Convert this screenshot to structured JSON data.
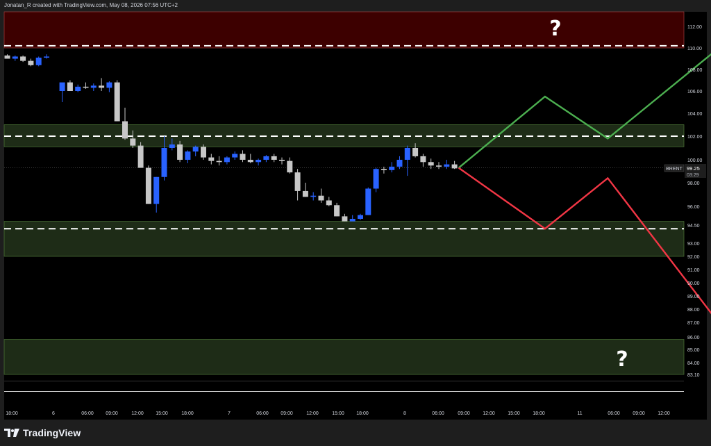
{
  "header": {
    "caption": "Jonatan_R created with TradingView.com, May 08, 2026 07:56 UTC+2"
  },
  "brand": {
    "name": "TradingView",
    "logo_icon": "tradingview-logo-icon"
  },
  "symbol_label": "BRENT",
  "last_price_label": "99.25",
  "countdown_label": "03:29",
  "question_mark": "?",
  "colors": {
    "background": "#000000",
    "frame": "#1e1e1e",
    "up_candle": "#2962ff",
    "down_candle": "#c7c7c7",
    "resistance_zone": "#3d0000",
    "support_zone": "#1e2c17",
    "bull_path": "#4caf50",
    "bear_path": "#f23645",
    "dashed_level": "#ffffff",
    "axis_text": "#d1d4dc"
  },
  "chart_data": {
    "type": "candlestick",
    "symbol": "BRENT",
    "y_axis_ticks": [
      "112.00",
      "110.00",
      "108.00",
      "106.00",
      "104.00",
      "102.00",
      "100.00",
      "98.00",
      "96.00",
      "94.50",
      "93.00",
      "92.00",
      "91.00",
      "90.00",
      "89.00",
      "88.00",
      "87.00",
      "86.00",
      "85.00",
      "84.00",
      "83.10"
    ],
    "x_axis_ticks": [
      "18:00",
      "6",
      "06:00",
      "09:00",
      "12:00",
      "15:00",
      "18:00",
      "7",
      "06:00",
      "09:00",
      "12:00",
      "15:00",
      "18:00",
      "8",
      "06:00",
      "09:00",
      "12:00",
      "15:00",
      "18:00",
      "11",
      "06:00",
      "09:00",
      "12:00"
    ],
    "candles": [
      {
        "o": 109.3,
        "h": 109.4,
        "l": 109.0,
        "c": 109.0
      },
      {
        "o": 109.0,
        "h": 109.3,
        "l": 108.8,
        "c": 109.2
      },
      {
        "o": 109.2,
        "h": 109.3,
        "l": 108.7,
        "c": 108.8
      },
      {
        "o": 108.8,
        "h": 109.0,
        "l": 108.3,
        "c": 108.4
      },
      {
        "o": 108.4,
        "h": 109.2,
        "l": 108.3,
        "c": 109.1
      },
      {
        "o": 109.1,
        "h": 109.4,
        "l": 109.0,
        "c": 109.2
      },
      {
        "gap": true
      },
      {
        "o": 106.0,
        "h": 106.5,
        "l": 105.0,
        "c": 106.8
      },
      {
        "o": 106.8,
        "h": 107.0,
        "l": 106.0,
        "c": 106.0
      },
      {
        "o": 106.0,
        "h": 106.6,
        "l": 105.9,
        "c": 106.4
      },
      {
        "o": 106.4,
        "h": 106.8,
        "l": 106.2,
        "c": 106.3
      },
      {
        "o": 106.3,
        "h": 106.7,
        "l": 106.0,
        "c": 106.5
      },
      {
        "o": 106.5,
        "h": 107.2,
        "l": 106.0,
        "c": 106.3
      },
      {
        "o": 106.3,
        "h": 106.9,
        "l": 105.9,
        "c": 106.8
      },
      {
        "o": 106.8,
        "h": 107.0,
        "l": 103.3,
        "c": 103.3
      },
      {
        "o": 103.3,
        "h": 104.5,
        "l": 101.7,
        "c": 101.8
      },
      {
        "o": 101.8,
        "h": 102.5,
        "l": 101.0,
        "c": 101.2
      },
      {
        "o": 101.2,
        "h": 101.5,
        "l": 99.3,
        "c": 99.3
      },
      {
        "o": 99.3,
        "h": 99.5,
        "l": 96.2,
        "c": 96.2
      },
      {
        "o": 96.2,
        "h": 98.5,
        "l": 95.5,
        "c": 98.5
      },
      {
        "o": 98.5,
        "h": 102.0,
        "l": 98.2,
        "c": 101.0
      },
      {
        "o": 101.0,
        "h": 101.8,
        "l": 100.8,
        "c": 101.3
      },
      {
        "o": 101.3,
        "h": 101.6,
        "l": 99.8,
        "c": 100.0
      },
      {
        "o": 100.0,
        "h": 100.8,
        "l": 99.7,
        "c": 100.7
      },
      {
        "o": 100.7,
        "h": 101.2,
        "l": 100.3,
        "c": 101.1
      },
      {
        "o": 101.1,
        "h": 101.3,
        "l": 100.0,
        "c": 100.2
      },
      {
        "o": 100.2,
        "h": 100.5,
        "l": 99.6,
        "c": 99.9
      },
      {
        "o": 99.9,
        "h": 100.3,
        "l": 99.5,
        "c": 99.8
      },
      {
        "o": 99.8,
        "h": 100.3,
        "l": 99.6,
        "c": 100.2
      },
      {
        "o": 100.2,
        "h": 100.7,
        "l": 100.0,
        "c": 100.5
      },
      {
        "o": 100.5,
        "h": 100.8,
        "l": 99.8,
        "c": 100.0
      },
      {
        "o": 100.0,
        "h": 100.5,
        "l": 99.7,
        "c": 99.8
      },
      {
        "o": 99.8,
        "h": 100.1,
        "l": 99.5,
        "c": 100.0
      },
      {
        "o": 100.0,
        "h": 100.4,
        "l": 99.8,
        "c": 100.3
      },
      {
        "o": 100.3,
        "h": 100.5,
        "l": 99.8,
        "c": 100.0
      },
      {
        "o": 100.0,
        "h": 100.2,
        "l": 99.6,
        "c": 99.9
      },
      {
        "o": 99.9,
        "h": 100.2,
        "l": 98.8,
        "c": 98.9
      },
      {
        "o": 98.9,
        "h": 99.2,
        "l": 96.5,
        "c": 97.3
      },
      {
        "o": 97.3,
        "h": 98.0,
        "l": 96.8,
        "c": 96.8
      },
      {
        "o": 96.8,
        "h": 97.2,
        "l": 96.5,
        "c": 96.9
      },
      {
        "o": 96.9,
        "h": 97.5,
        "l": 96.3,
        "c": 96.5
      },
      {
        "o": 96.5,
        "h": 96.8,
        "l": 96.0,
        "c": 96.1
      },
      {
        "o": 96.1,
        "h": 96.3,
        "l": 95.2,
        "c": 95.2
      },
      {
        "o": 95.2,
        "h": 95.4,
        "l": 94.8,
        "c": 94.8
      },
      {
        "o": 94.8,
        "h": 95.3,
        "l": 94.8,
        "c": 95.0
      },
      {
        "o": 95.0,
        "h": 95.4,
        "l": 94.9,
        "c": 95.3
      },
      {
        "o": 95.3,
        "h": 97.6,
        "l": 95.3,
        "c": 97.5
      },
      {
        "o": 97.5,
        "h": 99.3,
        "l": 97.2,
        "c": 99.2
      },
      {
        "o": 99.2,
        "h": 99.4,
        "l": 98.8,
        "c": 99.1
      },
      {
        "o": 99.1,
        "h": 99.8,
        "l": 98.9,
        "c": 99.4
      },
      {
        "o": 99.4,
        "h": 100.3,
        "l": 99.2,
        "c": 100.0
      },
      {
        "o": 100.0,
        "h": 101.2,
        "l": 98.6,
        "c": 101.0
      },
      {
        "o": 101.0,
        "h": 101.4,
        "l": 100.2,
        "c": 100.3
      },
      {
        "o": 100.3,
        "h": 100.5,
        "l": 99.4,
        "c": 99.8
      },
      {
        "o": 99.8,
        "h": 100.1,
        "l": 99.2,
        "c": 99.5
      },
      {
        "o": 99.5,
        "h": 99.8,
        "l": 99.2,
        "c": 99.4
      },
      {
        "o": 99.4,
        "h": 100.0,
        "l": 99.2,
        "c": 99.6
      },
      {
        "o": 99.6,
        "h": 99.9,
        "l": 99.2,
        "c": 99.25
      }
    ],
    "zones": [
      {
        "kind": "resistance",
        "from": 110.0,
        "to": 113.5
      },
      {
        "kind": "support",
        "from": 101.1,
        "to": 103.0
      },
      {
        "kind": "support",
        "from": 92.0,
        "to": 94.8
      },
      {
        "kind": "support",
        "from": 83.1,
        "to": 85.8
      }
    ],
    "dashed_levels": [
      110.2,
      102.0,
      94.2
    ],
    "projection_up": [
      [
        0,
        99.3
      ],
      [
        11,
        105.5
      ],
      [
        19,
        101.8
      ],
      [
        34,
        110.5
      ],
      [
        36,
        109.3
      ]
    ],
    "projection_down": [
      [
        0,
        99.3
      ],
      [
        11,
        94.2
      ],
      [
        19,
        98.4
      ],
      [
        35,
        85.6
      ]
    ]
  }
}
